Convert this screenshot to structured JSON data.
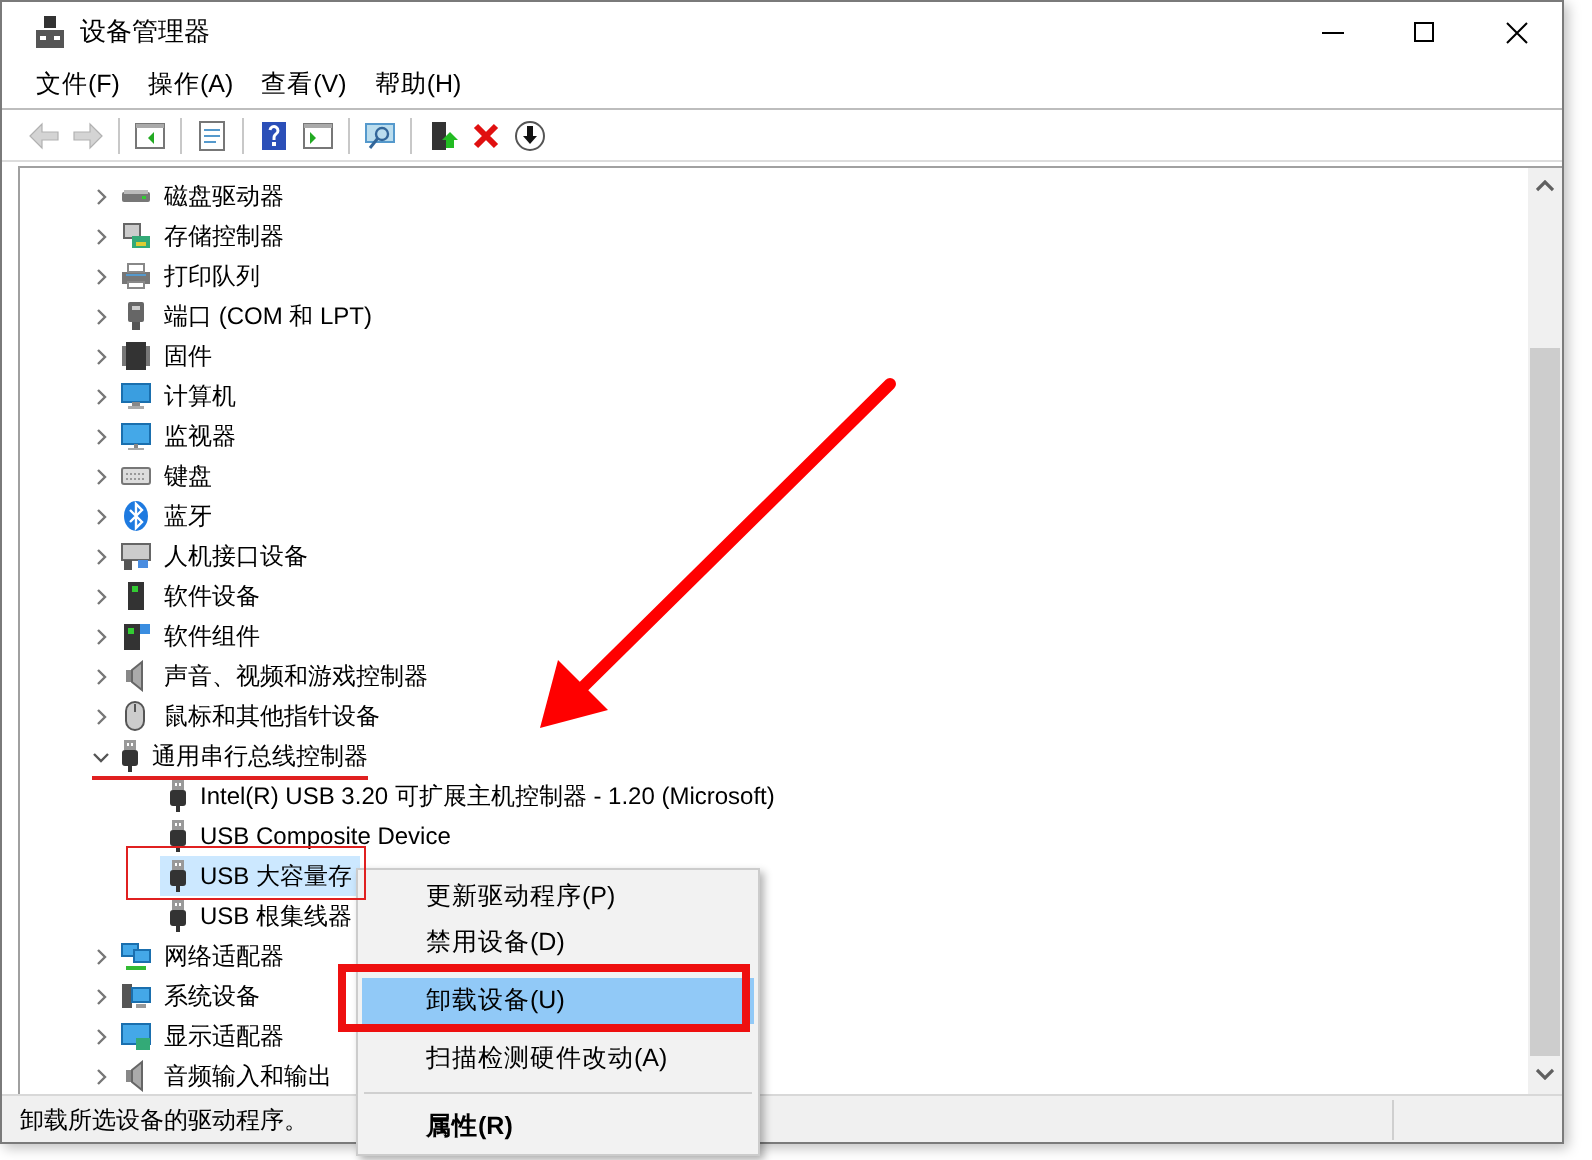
{
  "window": {
    "title": "设备管理器"
  },
  "menu_bar": [
    "文件(F)",
    "操作(A)",
    "查看(V)",
    "帮助(H)"
  ],
  "toolbar": [
    {
      "disabled": true
    },
    {
      "disabled": true
    },
    {
      "disabled": false
    },
    {
      "disabled": false
    },
    {
      "disabled": false
    },
    {
      "disabled": false
    },
    {
      "disabled": false
    },
    {
      "disabled": false
    },
    {
      "disabled": false
    },
    {
      "disabled": false
    }
  ],
  "tree": [
    {
      "label": "磁盘驱动器",
      "expanded": false,
      "selected": false
    },
    {
      "label": "存储控制器",
      "expanded": false,
      "selected": false
    },
    {
      "label": "打印队列",
      "expanded": false,
      "selected": false
    },
    {
      "label": "端口 (COM 和 LPT)",
      "expanded": false,
      "selected": false
    },
    {
      "label": "固件",
      "expanded": false,
      "selected": false
    },
    {
      "label": "计算机",
      "expanded": false,
      "selected": false
    },
    {
      "label": "监视器",
      "expanded": false,
      "selected": false
    },
    {
      "label": "键盘",
      "expanded": false,
      "selected": false
    },
    {
      "label": "蓝牙",
      "expanded": false,
      "selected": false
    },
    {
      "label": "人机接口设备",
      "expanded": false,
      "selected": false
    },
    {
      "label": "软件设备",
      "expanded": false,
      "selected": false
    },
    {
      "label": "软件组件",
      "expanded": false,
      "selected": false
    },
    {
      "label": "声音、视频和游戏控制器",
      "expanded": false,
      "selected": false
    },
    {
      "label": "鼠标和其他指针设备",
      "expanded": false,
      "selected": false
    },
    {
      "label": "通用串行总线控制器",
      "expanded": true,
      "selected": false,
      "children": [
        {
          "label": "Intel(R) USB 3.20 可扩展主机控制器 - 1.20 (Microsoft)",
          "selected": false
        },
        {
          "label": "USB Composite Device",
          "selected": false
        },
        {
          "label": "USB 大容量存",
          "selected": true
        },
        {
          "label": "USB 根集线器",
          "selected": false
        }
      ]
    },
    {
      "label": "网络适配器",
      "expanded": false,
      "selected": false
    },
    {
      "label": "系统设备",
      "expanded": false,
      "selected": false
    },
    {
      "label": "显示适配器",
      "expanded": false,
      "selected": false
    },
    {
      "label": "音频输入和输出",
      "expanded": false,
      "selected": false
    }
  ],
  "context_menu": [
    {
      "label": "更新驱动程序(P)",
      "selected": false,
      "default": false,
      "separator_before": false
    },
    {
      "label": "禁用设备(D)",
      "selected": false,
      "default": false,
      "separator_before": false
    },
    {
      "label": "卸载设备(U)",
      "selected": true,
      "default": false,
      "separator_before": false
    },
    {
      "label": "扫描检测硬件改动(A)",
      "selected": false,
      "default": false,
      "separator_before": false
    },
    {
      "label": "属性(R)",
      "selected": false,
      "default": true,
      "separator_before": true
    }
  ],
  "status_bar": "卸载所选设备的驱动程序。"
}
